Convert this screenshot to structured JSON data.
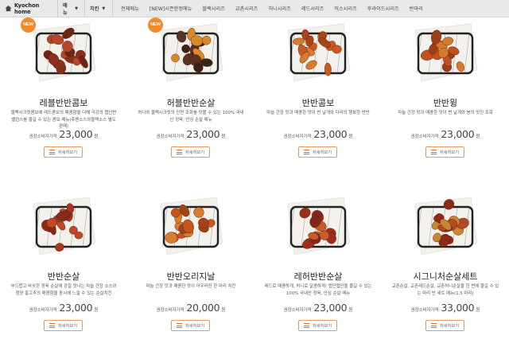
{
  "nav": {
    "home_label": "Kyochon home",
    "menu_label": "메뉴",
    "chicken_label": "치킨",
    "caret": "▼",
    "categories": [
      "전체메뉴",
      "[NEW]시즌한정메뉴",
      "블랙시리즈",
      "교촌시리즈",
      "허니시리즈",
      "레드시리즈",
      "믹스시리즈",
      "후라이드시리즈",
      "반마리"
    ]
  },
  "products": [
    {
      "name": "레블반반콤보",
      "badge": "NEW",
      "desc": "블랙시크릿콤보에 레드콤보의 매콤함을 더해 극강의 맵단짠 밸런스를 즐길 수 있는 콤보 메뉴(후첸소스와블랙소스 별도판매)",
      "price_label": "권장소비자가격",
      "price": "23,000",
      "won": "원",
      "more": "자세히보기",
      "colors": [
        "#8a2f1c",
        "#b4462a",
        "#6e2416"
      ]
    },
    {
      "name": "허블반반순살",
      "badge": "NEW",
      "desc": "허니와 블랙시크릿의 단짠 조화를 맛볼 수 있는 100% 국내산 정육, 안심 순살 메뉴",
      "price_label": "권장소비자가격",
      "price": "23,000",
      "won": "원",
      "more": "자세히보기",
      "colors": [
        "#3a2418",
        "#d88a2a",
        "#5a3320"
      ]
    },
    {
      "name": "반반콤보",
      "badge": "",
      "desc": "마늘 간장 맛과 매콤한 맛이 번 날개와 다리의 행복한 반반",
      "price_label": "권장소비자가격",
      "price": "23,000",
      "won": "원",
      "more": "자세히보기",
      "colors": [
        "#c85a22",
        "#d87a30",
        "#a84418"
      ]
    },
    {
      "name": "반반윙",
      "badge": "",
      "desc": "마늘 간장 맛과 매콤한 맛이 번 날개와 봉의 맛진 조화",
      "price_label": "권장소비자가격",
      "price": "23,000",
      "won": "원",
      "more": "자세히보기",
      "colors": [
        "#c0501e",
        "#d67a2c",
        "#9c3e18"
      ]
    },
    {
      "name": "반반순살",
      "badge": "",
      "desc": "부드럽고 바삭한 정육 순살에 감칠 맛나는 마늘 간장 소스와 청양 홍고추의 매콤함을 동시에 느낄 수 있는 순살치킨",
      "price_label": "권장소비자가격",
      "price": "23,000",
      "won": "원",
      "more": "자세히보기",
      "colors": [
        "#a8361c",
        "#c04824",
        "#8a2a16"
      ]
    },
    {
      "name": "반반오리지날",
      "badge": "",
      "desc": "마늘 간장 맛과 매콤한 맛이 어우러진 한 마리 치킨",
      "price_label": "권장소비자가격",
      "price": "20,000",
      "won": "원",
      "more": "자세히보기",
      "colors": [
        "#c4561e",
        "#d87c2e",
        "#a44216"
      ]
    },
    {
      "name": "레허반반순살",
      "badge": "",
      "desc": "레드로 매콤하게, 허니로 달콤하게! 맵단맵단을 즐길 수 있는 100% 국내산 정육, 안심 순살 메뉴",
      "price_label": "권장소비자가격",
      "price": "23,000",
      "won": "원",
      "more": "자세히보기",
      "colors": [
        "#9e2e1c",
        "#c75c2a",
        "#80261a"
      ]
    },
    {
      "name": "시그니처순살세트",
      "badge": "",
      "desc": "교촌순살, 교촌레드순살, 교촌허니순살을 한 번에 즐길 수 있는 마리 반 세트 메뉴(1.5 마리)",
      "price_label": "권장소비자가격",
      "price": "33,000",
      "won": "원",
      "more": "자세히보기",
      "colors": [
        "#8e2a18",
        "#c8862e",
        "#b04a22"
      ]
    }
  ]
}
